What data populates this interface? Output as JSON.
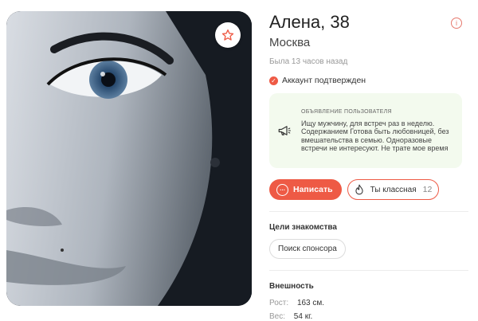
{
  "profile": {
    "name_age": "Алена, 38",
    "city": "Москва",
    "last_seen": "Была 13 часов назад",
    "verified": "Аккаунт подтвержден"
  },
  "announcement": {
    "label": "объявление пользователя",
    "text": "Ищу мужчину, для встреч раз в неделю. Содержанием Готова быть любовницей, без вмешательства в семью. Одноразовые встречи не интересуют. Не трате мое время"
  },
  "actions": {
    "write": "Написать",
    "like": "Ты классная",
    "like_count": "12"
  },
  "goals": {
    "title": "Цели знакомства",
    "chip": "Поиск спонсора"
  },
  "appearance": {
    "title": "Внешность",
    "height_label": "Рост:",
    "height_value": "163 см.",
    "weight_label": "Вес:",
    "weight_value": "54 кг."
  },
  "colors": {
    "accent": "#ee5a45",
    "announce_bg": "#f3faee"
  },
  "icons": [
    "star-icon",
    "info-icon",
    "check-icon",
    "megaphone-icon",
    "chat-icon",
    "flame-icon"
  ]
}
